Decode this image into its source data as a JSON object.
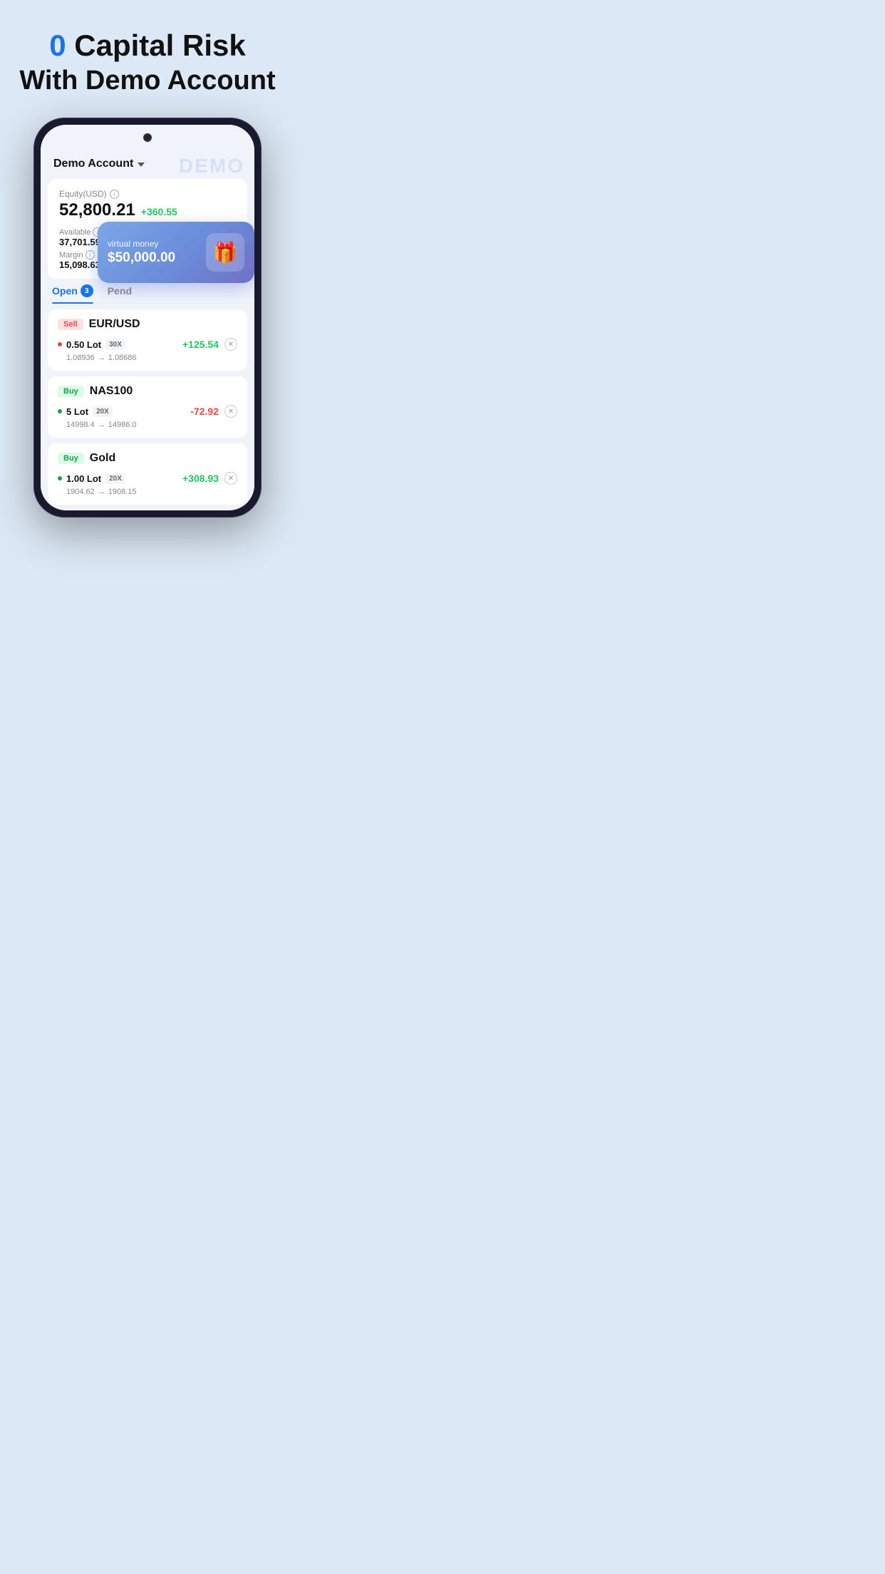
{
  "hero": {
    "line1_zero": "0",
    "line1_rest": " Capital Risk",
    "line2": "With Demo Account"
  },
  "phone": {
    "account_name": "Demo Account",
    "demo_watermark": "DEMO",
    "equity_label": "Equity(USD)",
    "equity_value": "52,800.21",
    "equity_change": "+360.55",
    "available_label": "Available",
    "available_value": "37,701.59",
    "margin_label": "Margin",
    "margin_value": "15,098.63",
    "virtual_card": {
      "label": "virtual money",
      "amount": "$50,000.00"
    },
    "tabs": [
      {
        "label": "Open",
        "badge": "3",
        "active": true
      },
      {
        "label": "Pend",
        "badge": "",
        "active": false
      }
    ],
    "trades": [
      {
        "side": "Sell",
        "symbol": "EUR/USD",
        "lot": "0.50 Lot",
        "leverage": "30X",
        "pnl": "+125.54",
        "pnl_type": "positive",
        "price_from": "1.08936",
        "price_to": "1.08686"
      },
      {
        "side": "Buy",
        "symbol": "NAS100",
        "lot": "5 Lot",
        "leverage": "20X",
        "pnl": "-72.92",
        "pnl_type": "negative",
        "price_from": "14998.4",
        "price_to": "14986.0"
      },
      {
        "side": "Buy",
        "symbol": "Gold",
        "lot": "1.00 Lot",
        "leverage": "20X",
        "pnl": "+308.93",
        "pnl_type": "positive",
        "price_from": "1904.62",
        "price_to": "1908.15"
      }
    ]
  }
}
